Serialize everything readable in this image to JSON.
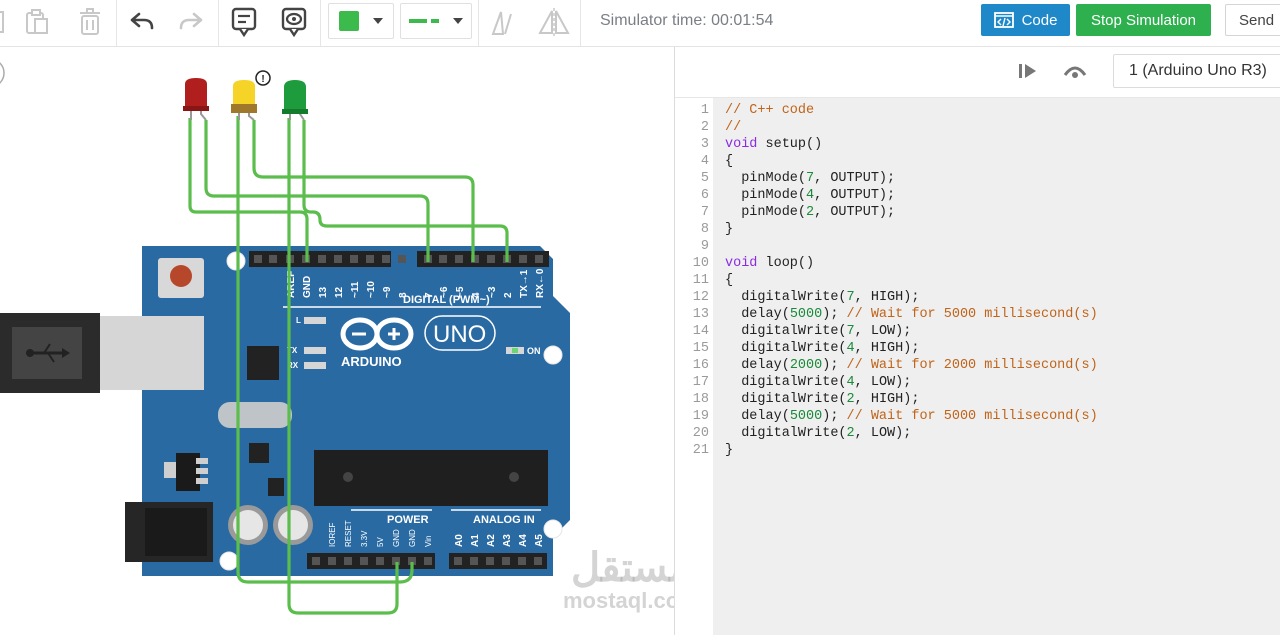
{
  "toolbar": {
    "sim_time": "Simulator time: 00:01:54",
    "code_label": "Code",
    "stop_label": "Stop Simulation",
    "send_label": "Send",
    "fill_color": "#3cba4c",
    "line_color": "#3cba4c",
    "icons": [
      "copy-icon",
      "paste-icon",
      "delete-icon",
      "undo-icon",
      "redo-icon",
      "note-icon",
      "visibility-icon",
      "color-picker",
      "line-style-picker",
      "mirror-icon",
      "flip-icon"
    ]
  },
  "code_panel": {
    "device": "1 (Arduino Uno R3)",
    "lines": [
      {
        "n": "1",
        "t": "// C++ code"
      },
      {
        "n": "2",
        "t": "//"
      },
      {
        "n": "3",
        "t": "void setup()"
      },
      {
        "n": "4",
        "t": "{"
      },
      {
        "n": "5",
        "t": "  pinMode(7, OUTPUT);"
      },
      {
        "n": "6",
        "t": "  pinMode(4, OUTPUT);"
      },
      {
        "n": "7",
        "t": "  pinMode(2, OUTPUT);"
      },
      {
        "n": "8",
        "t": "}"
      },
      {
        "n": "9",
        "t": ""
      },
      {
        "n": "10",
        "t": "void loop()"
      },
      {
        "n": "11",
        "t": "{"
      },
      {
        "n": "12",
        "t": "  digitalWrite(7, HIGH);"
      },
      {
        "n": "13",
        "t": "  delay(5000); // Wait for 5000 millisecond(s)"
      },
      {
        "n": "14",
        "t": "  digitalWrite(7, LOW);"
      },
      {
        "n": "15",
        "t": "  digitalWrite(4, HIGH);"
      },
      {
        "n": "16",
        "t": "  delay(2000); // Wait for 2000 millisecond(s)"
      },
      {
        "n": "17",
        "t": "  digitalWrite(4, LOW);"
      },
      {
        "n": "18",
        "t": "  digitalWrite(2, HIGH);"
      },
      {
        "n": "19",
        "t": "  delay(5000); // Wait for 5000 millisecond(s)"
      },
      {
        "n": "20",
        "t": "  digitalWrite(2, LOW);"
      },
      {
        "n": "21",
        "t": "}"
      }
    ]
  },
  "board": {
    "brand": "ARDUINO",
    "model": "UNO",
    "digital_label": "DIGITAL (PWM~)",
    "power_label": "POWER",
    "analog_label": "ANALOG IN",
    "on_label": "ON",
    "l_label": "L",
    "tx_label": "TX",
    "rx_label": "RX",
    "digital_pins": [
      "AREF",
      "GND",
      "13",
      "12",
      "~11",
      "~10",
      "~9",
      "8",
      "7",
      "~6",
      "~5",
      "4",
      "~3",
      "2",
      "TX→1",
      "RX←0"
    ],
    "power_pins": [
      "IOREF",
      "RESET",
      "3.3V",
      "5V",
      "GND",
      "GND",
      "Vin"
    ],
    "analog_pins": [
      "A0",
      "A1",
      "A2",
      "A3",
      "A4",
      "A5"
    ],
    "warning_mark": "!"
  },
  "leds": [
    {
      "name": "red",
      "color": "#b01e1e"
    },
    {
      "name": "yellow",
      "color": "#f5d327"
    },
    {
      "name": "green",
      "color": "#1e9b3c"
    }
  ],
  "watermark": {
    "arabic": "مستقل",
    "latin": "mostaql.com"
  }
}
